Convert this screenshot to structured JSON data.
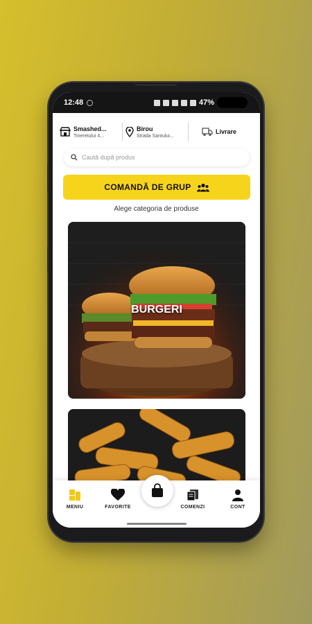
{
  "status_bar": {
    "time": "12:48",
    "battery": "47%"
  },
  "header": {
    "restaurant": {
      "name": "Smashed...",
      "address": "Tineretului 4..."
    },
    "location": {
      "name": "Birou",
      "address": "Strada Santului..."
    },
    "delivery_label": "Livrare"
  },
  "search": {
    "placeholder": "Caută după produs"
  },
  "group_order": {
    "label": "COMANDĂ DE GRUP"
  },
  "category_prompt": "Alege categoria de produse",
  "categories": [
    {
      "label": "BURGERI"
    },
    {
      "label": ""
    }
  ],
  "bottom_nav": {
    "menu": "MENIU",
    "favorites": "FAVORITE",
    "orders": "COMENZI",
    "account": "CONT"
  },
  "colors": {
    "accent": "#f7d41c",
    "dark": "#151515"
  }
}
